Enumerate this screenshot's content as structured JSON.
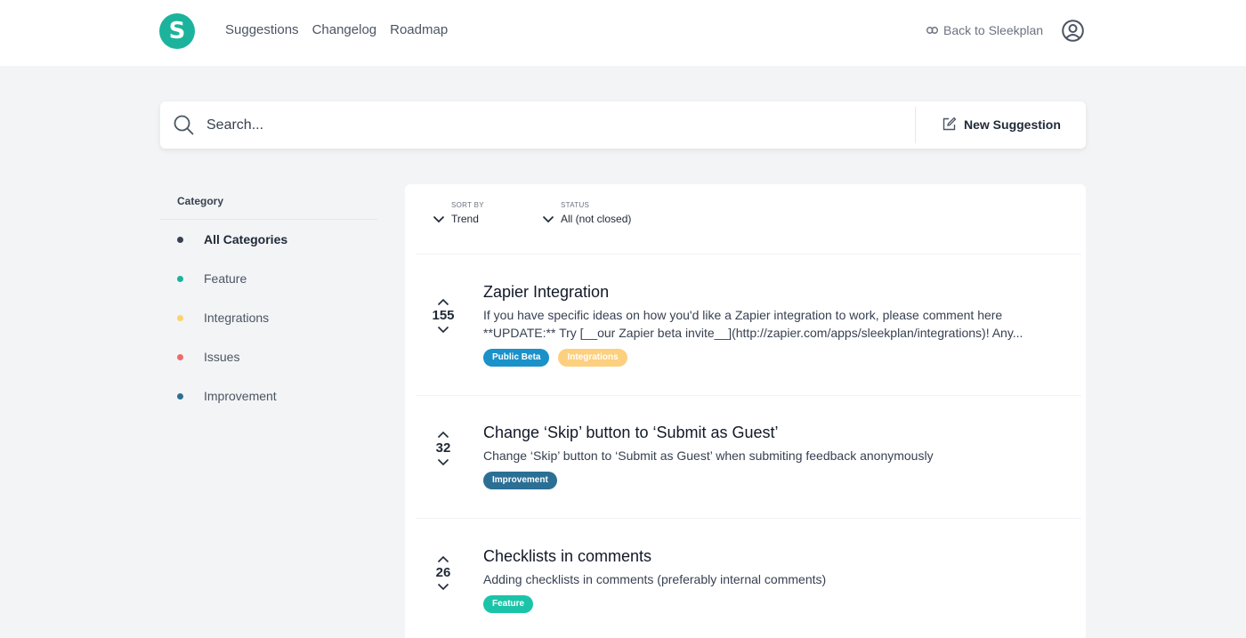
{
  "logo": {
    "letter": "S",
    "color": "#1bb39c"
  },
  "nav": {
    "suggestions": "Suggestions",
    "changelog": "Changelog",
    "roadmap": "Roadmap"
  },
  "back_link": {
    "label": "Back to Sleekplan",
    "icon": "link-icon"
  },
  "account": {
    "icon": "account-circle-icon"
  },
  "search": {
    "placeholder": "Search...",
    "value": ""
  },
  "new_suggestion": {
    "label": "New Suggestion",
    "icon": "edit-icon"
  },
  "sidebar": {
    "heading": "Category",
    "items": [
      {
        "label": "All Categories",
        "color": "#374151",
        "active": true
      },
      {
        "label": "Feature",
        "color": "#1bb39c"
      },
      {
        "label": "Integrations",
        "color": "#fcd36b"
      },
      {
        "label": "Issues",
        "color": "#ef6b6b"
      },
      {
        "label": "Improvement",
        "color": "#2b6f95"
      }
    ]
  },
  "filters": {
    "sort_caption": "SORT BY",
    "sort_value": "Trend",
    "status_caption": "STATUS",
    "status_value": "All (not closed)"
  },
  "posts": [
    {
      "votes": "155",
      "title": "Zapier Integration",
      "desc_line1": "If you have specific ideas on how you'd like a Zapier integration to work, please comment here",
      "desc_line2": "**UPDATE:** Try [__our Zapier beta invite__](http://zapier.com/apps/sleekplan/integrations)! Any...",
      "tags": [
        {
          "label": "Public Beta",
          "color": "#1a91c9"
        },
        {
          "label": "Integrations",
          "color": "#fcd07f"
        }
      ]
    },
    {
      "votes": "32",
      "title": "Change ‘Skip’ button to ‘Submit as Guest’",
      "desc_line1": "Change ‘Skip’ button to ‘Submit as Guest’ when submiting feedback anonymously",
      "tags": [
        {
          "label": "Improvement",
          "color": "#2b6f95"
        }
      ]
    },
    {
      "votes": "26",
      "title": "Checklists in comments",
      "desc_line1": "Adding checklists in comments (preferably internal comments)",
      "tags": [
        {
          "label": "Feature",
          "color": "#1bc4a8"
        }
      ]
    }
  ]
}
